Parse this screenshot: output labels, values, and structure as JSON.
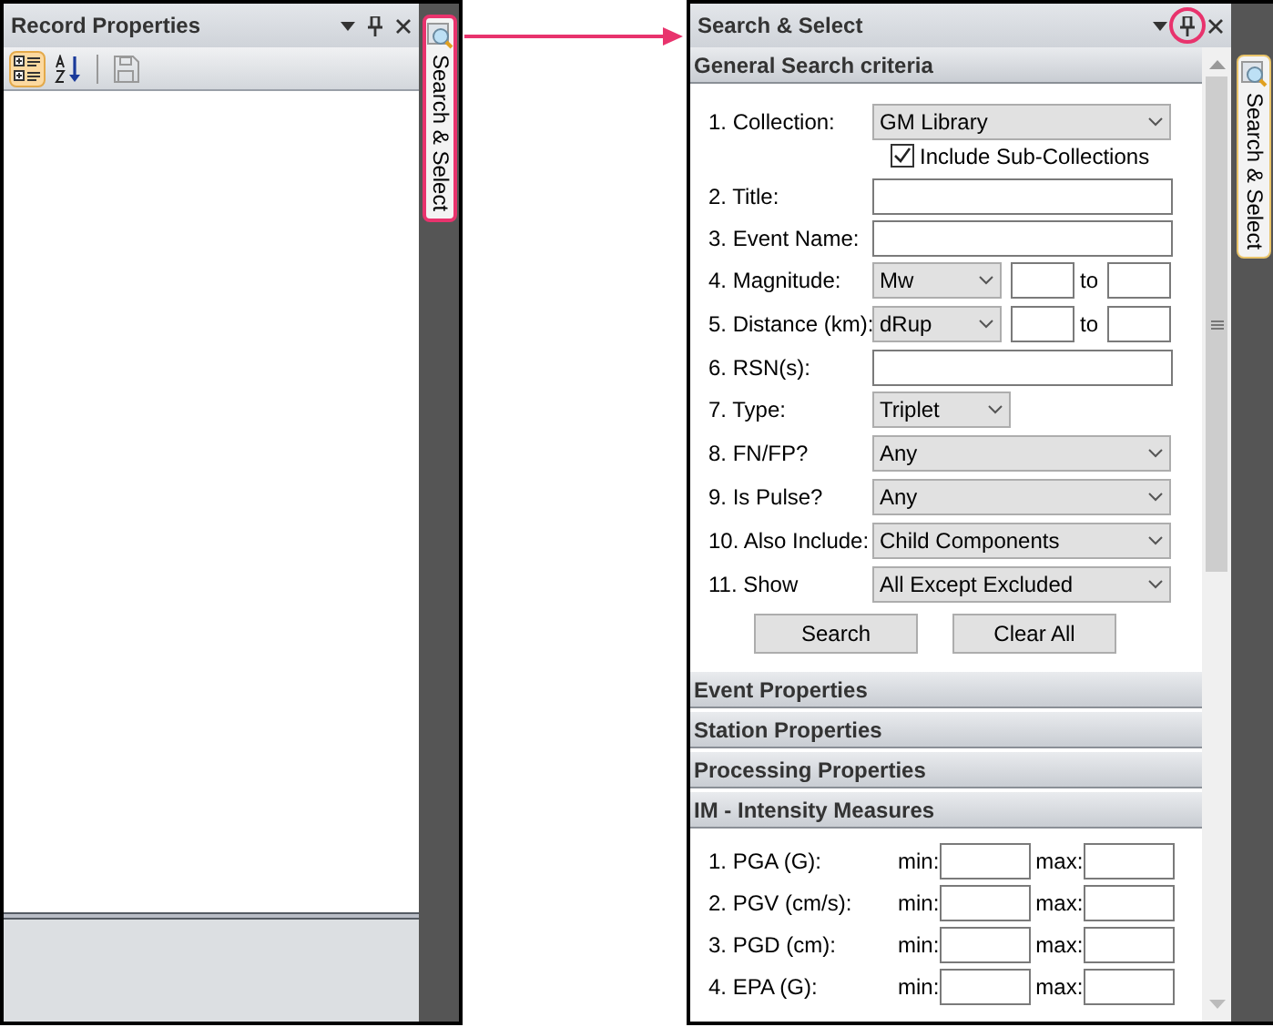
{
  "left_panel": {
    "title": "Record Properties",
    "toolbar": [
      {
        "kind": "categorized",
        "selected": true
      },
      {
        "kind": "alphabetical",
        "selected": false
      },
      {
        "kind": "save",
        "selected": false
      }
    ]
  },
  "left_side_tab": {
    "label": "Search & Select",
    "highlighted": true
  },
  "right_panel": {
    "title": "Search & Select",
    "pin_highlighted": true,
    "sections": [
      {
        "title": "General Search criteria",
        "kind": "criteria",
        "fields": [
          {
            "kind": "select",
            "label": "1. Collection:",
            "value": "GM Library"
          },
          {
            "kind": "checkbox",
            "label": "Include Sub-Collections",
            "checked": true
          },
          {
            "kind": "text",
            "label": "2. Title:"
          },
          {
            "kind": "text",
            "label": "3. Event Name:"
          },
          {
            "kind": "range",
            "label": "4. Magnitude:",
            "value": "Mw",
            "to": "to"
          },
          {
            "kind": "range",
            "label": "5. Distance (km):",
            "value": "dRup",
            "to": "to"
          },
          {
            "kind": "text",
            "label": "6. RSN(s):"
          },
          {
            "kind": "short_select",
            "label": "7. Type:",
            "value": "Triplet"
          },
          {
            "kind": "select",
            "label": "8. FN/FP?",
            "value": "Any"
          },
          {
            "kind": "select",
            "label": "9. Is Pulse?",
            "value": "Any"
          },
          {
            "kind": "select",
            "label": "10. Also Include:",
            "value": "Child Components"
          },
          {
            "kind": "select",
            "label": "11. Show",
            "value": "All Except Excluded"
          }
        ],
        "buttons": [
          "Search",
          "Clear All"
        ]
      },
      {
        "title": "Event Properties"
      },
      {
        "title": "Station Properties"
      },
      {
        "title": "Processing Properties"
      },
      {
        "title": "IM - Intensity Measures",
        "kind": "measures",
        "rows": [
          {
            "label": "1. PGA (G):",
            "min": "min:",
            "max": "max:"
          },
          {
            "label": "2. PGV (cm/s):",
            "min": "min:",
            "max": "max:"
          },
          {
            "label": "3. PGD (cm):",
            "min": "min:",
            "max": "max:"
          },
          {
            "label": "4. EPA (G):",
            "min": "min:",
            "max": "max:"
          }
        ]
      }
    ]
  },
  "right_side_tab": {
    "label": "Search & Select",
    "highlighted": false
  }
}
